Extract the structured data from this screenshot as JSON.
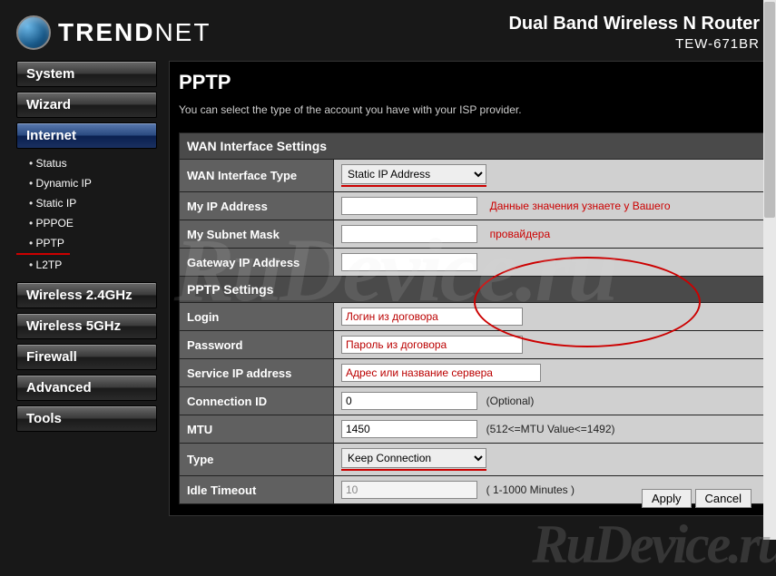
{
  "brand": {
    "name": "TRENDNET",
    "name_prefix": "TREND",
    "name_suffix": "NET"
  },
  "product": {
    "line1": "Dual Band Wireless N Router",
    "line2": "TEW-671BR"
  },
  "sidebar": {
    "main": [
      {
        "label": "System"
      },
      {
        "label": "Wizard"
      },
      {
        "label": "Internet",
        "active": true
      },
      {
        "label": "Wireless 2.4GHz"
      },
      {
        "label": "Wireless 5GHz"
      },
      {
        "label": "Firewall"
      },
      {
        "label": "Advanced"
      },
      {
        "label": "Tools"
      }
    ],
    "internet_sub": [
      {
        "label": "Status"
      },
      {
        "label": "Dynamic IP"
      },
      {
        "label": "Static IP"
      },
      {
        "label": "PPPOE"
      },
      {
        "label": "PPTP",
        "current": true
      },
      {
        "label": "L2TP"
      }
    ]
  },
  "page": {
    "title": "PPTP",
    "desc": "You can select the type of the account you have with your ISP provider."
  },
  "section1": {
    "header": "WAN Interface Settings"
  },
  "wan_type": {
    "label": "WAN Interface Type",
    "selected": "Static IP Address"
  },
  "my_ip": {
    "label": "My IP Address",
    "value": ""
  },
  "my_mask": {
    "label": "My Subnet Mask",
    "value": ""
  },
  "gateway": {
    "label": "Gateway IP Address",
    "value": ""
  },
  "section2": {
    "header": "PPTP Settings"
  },
  "login": {
    "label": "Login",
    "value": "Логин из договора"
  },
  "password": {
    "label": "Password",
    "value": "Пароль из договора"
  },
  "service_ip": {
    "label": "Service IP address",
    "value": "Адрес или название сервера"
  },
  "conn_id": {
    "label": "Connection ID",
    "value": "0",
    "hint": "(Optional)"
  },
  "mtu": {
    "label": "MTU",
    "value": "1450",
    "hint": "(512<=MTU Value<=1492)"
  },
  "type": {
    "label": "Type",
    "selected": "Keep Connection"
  },
  "idle": {
    "label": "Idle Timeout",
    "value": "10",
    "hint": "( 1-1000 Minutes )"
  },
  "notes": {
    "right1": "Данные значения узнаете у Вашего",
    "right2": "провайдера"
  },
  "buttons": {
    "apply": "Apply",
    "cancel": "Cancel"
  },
  "watermark": "RuDevice.ru"
}
